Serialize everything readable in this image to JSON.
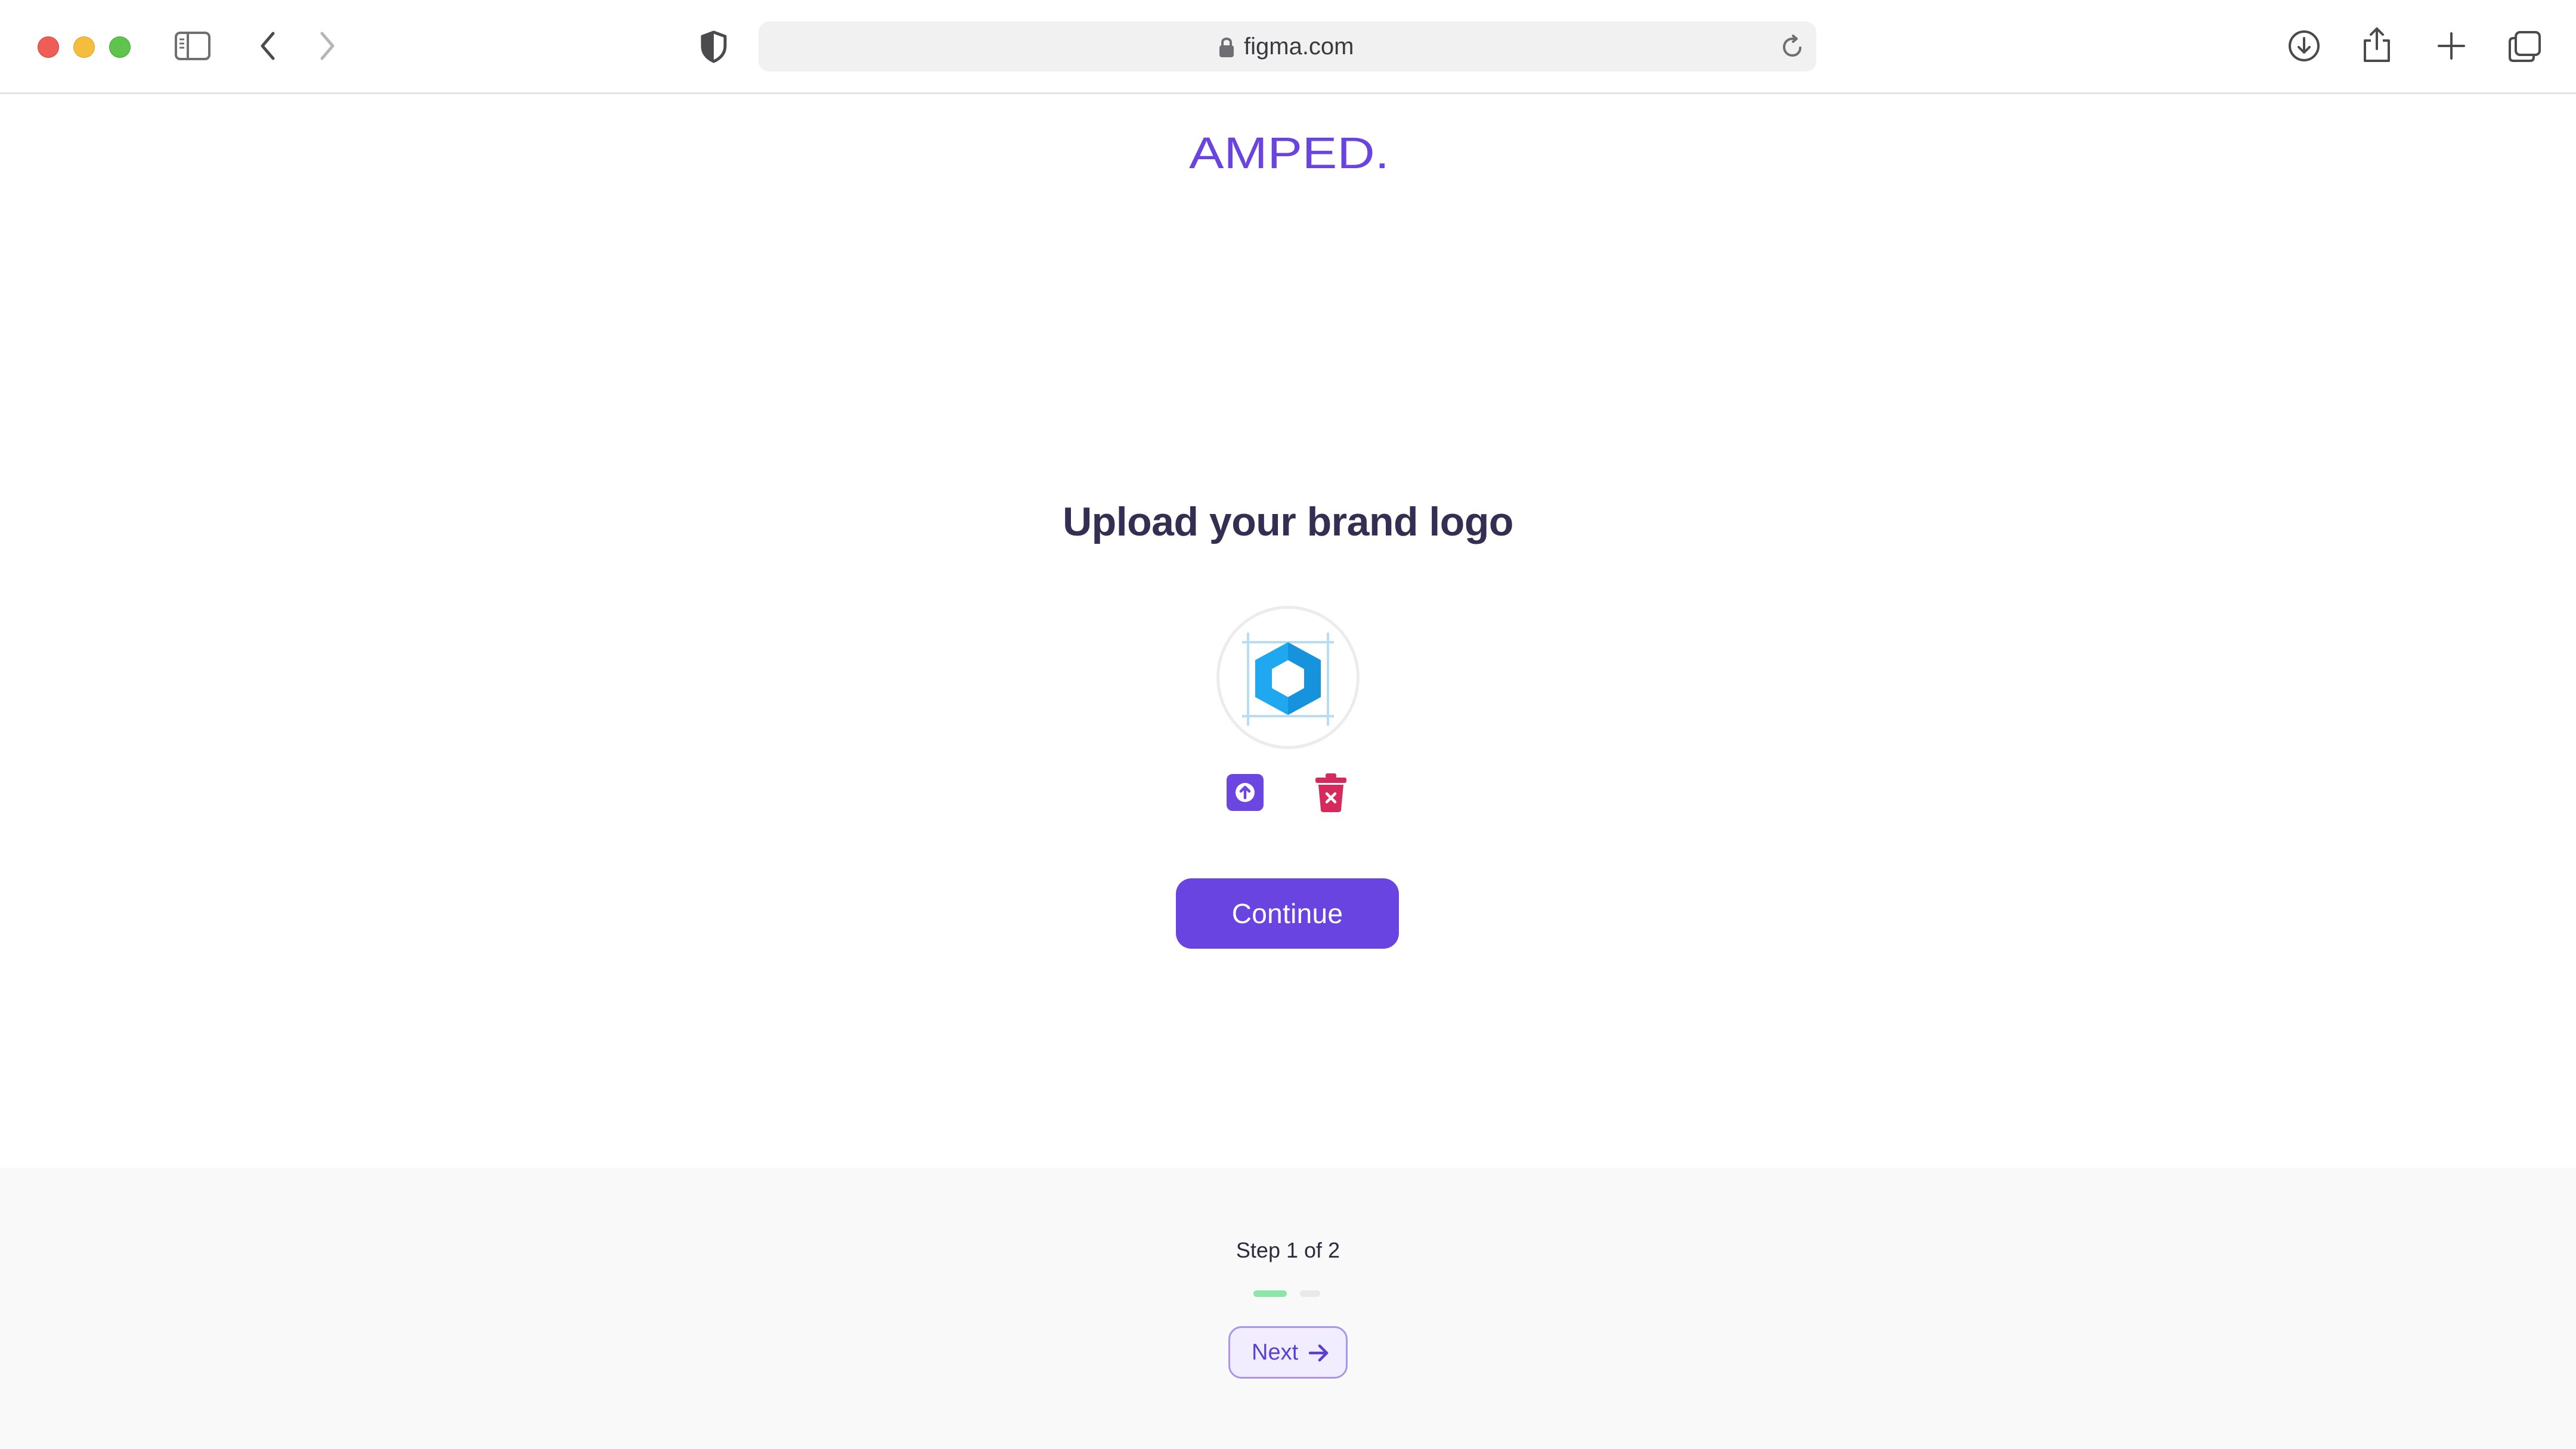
{
  "browser": {
    "url": "figma.com",
    "icons": [
      "sidebar-icon",
      "back-icon",
      "forward-icon",
      "shield-icon",
      "lock-icon",
      "reload-icon",
      "download-icon",
      "share-icon",
      "new-tab-icon",
      "tabs-overview-icon"
    ]
  },
  "brand": {
    "logo_text": "AMPED.",
    "color": "#6a44e0"
  },
  "main": {
    "title": "Upload your brand logo",
    "preview_icon": "hexagon-logo-icon",
    "upload_icon": "upload-arrow-icon",
    "delete_icon": "trash-icon",
    "continue_label": "Continue"
  },
  "footer": {
    "step_text": "Step 1 of 2",
    "current_step": 1,
    "total_steps": 2,
    "next_label": "Next",
    "next_icon": "arrow-right-icon"
  },
  "colors": {
    "primary": "#6a44e0",
    "title": "#322f52",
    "delete": "#d62a5c",
    "progress_active": "#8ce6aa",
    "progress_inactive": "#e9e9ec",
    "logo_blue": "#1fa8f0"
  }
}
